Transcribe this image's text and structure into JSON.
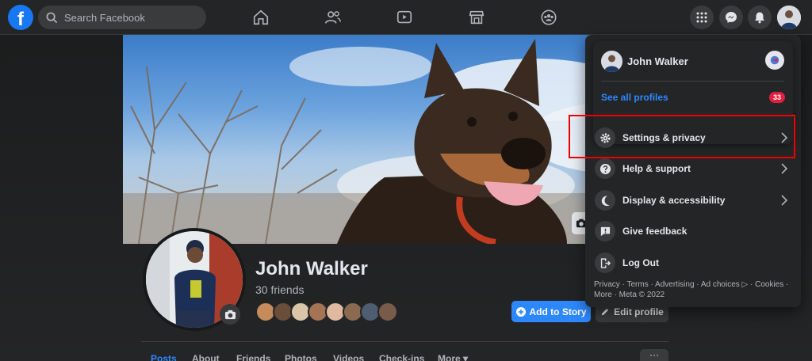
{
  "topbar": {
    "logo_letter": "f",
    "search_placeholder": "Search Facebook"
  },
  "profile": {
    "name": "John Walker",
    "friends_count": "30 friends",
    "add_story_label": "Add to Story",
    "edit_profile_label": "Edit profile"
  },
  "tabs": [
    {
      "label": "Posts"
    },
    {
      "label": "About"
    },
    {
      "label": "Friends"
    },
    {
      "label": "Photos"
    },
    {
      "label": "Videos"
    },
    {
      "label": "Check-ins"
    },
    {
      "label": "More ▾"
    }
  ],
  "tabs_more_dots": "···",
  "menu": {
    "profile_name": "John Walker",
    "see_all_profiles": "See all profiles",
    "notification_count": "33",
    "items": [
      {
        "label": "Settings & privacy",
        "icon": "gear-icon"
      },
      {
        "label": "Help & support",
        "icon": "question-icon"
      },
      {
        "label": "Display & accessibility",
        "icon": "moon-icon"
      },
      {
        "label": "Give feedback",
        "icon": "feedback-icon"
      },
      {
        "label": "Log Out",
        "icon": "logout-icon"
      }
    ],
    "footer_line1": "Privacy · Terms · Advertising · Ad choices ▷ · Cookies ·",
    "footer_line2": "More · Meta © 2022"
  },
  "colors": {
    "accent": "#2d88ff",
    "facebook_blue": "#1877f2",
    "badge": "#e41e3f",
    "highlight_box": "#ee0000"
  }
}
